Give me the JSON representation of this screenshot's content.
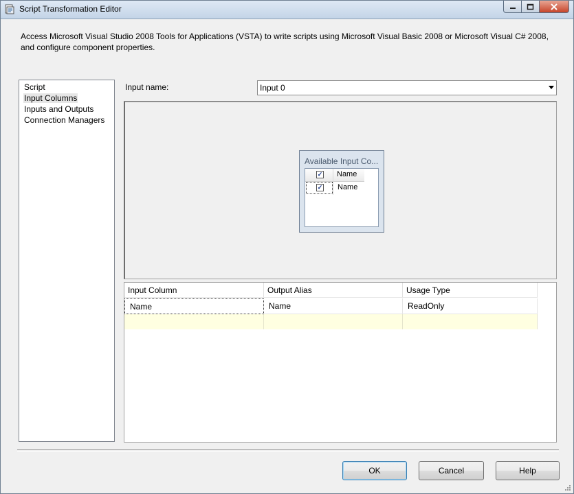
{
  "window": {
    "title": "Script Transformation Editor"
  },
  "description": "Access Microsoft Visual Studio 2008 Tools for Applications (VSTA) to write scripts using Microsoft Visual Basic 2008 or Microsoft Visual C# 2008, and configure component properties.",
  "nav": {
    "items": [
      {
        "label": "Script",
        "selected": false
      },
      {
        "label": "Input Columns",
        "selected": true
      },
      {
        "label": "Inputs and Outputs",
        "selected": false
      },
      {
        "label": "Connection Managers",
        "selected": false
      }
    ]
  },
  "input": {
    "label": "Input name:",
    "value": "Input 0"
  },
  "available": {
    "title": "Available Input Co...",
    "header": {
      "checked": true,
      "label": "Name"
    },
    "rows": [
      {
        "checked": true,
        "label": "Name"
      }
    ]
  },
  "grid": {
    "columns": [
      "Input Column",
      "Output Alias",
      "Usage Type"
    ],
    "rows": [
      [
        "Name",
        "Name",
        "ReadOnly"
      ]
    ]
  },
  "buttons": {
    "ok": "OK",
    "cancel": "Cancel",
    "help": "Help"
  }
}
